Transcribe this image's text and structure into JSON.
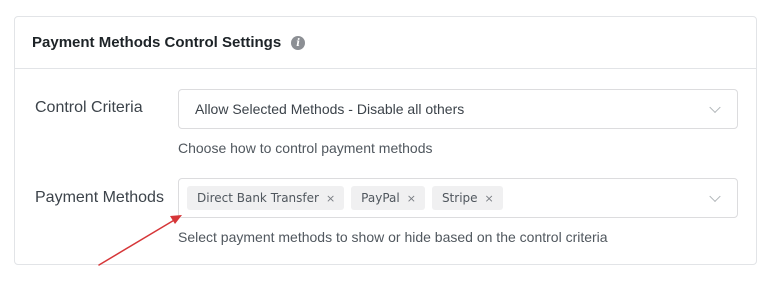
{
  "panel": {
    "title": "Payment Methods Control Settings",
    "info_icon": "info-icon"
  },
  "control_criteria": {
    "label": "Control Criteria",
    "selected": "Allow Selected Methods - Disable all others",
    "help": "Choose how to control payment methods"
  },
  "payment_methods": {
    "label": "Payment Methods",
    "tags": [
      {
        "label": "Direct Bank Transfer",
        "remove": "×"
      },
      {
        "label": "PayPal",
        "remove": "×"
      },
      {
        "label": "Stripe",
        "remove": "×"
      }
    ],
    "help": "Select payment methods to show or hide based on the control criteria"
  },
  "annotation": {
    "arrow_color": "#d63638",
    "arrow_icon": "arrow-annotation-icon"
  },
  "colors": {
    "border": "#e2e4e7",
    "tag_background": "#f0f0f1",
    "label_text": "#3c434a"
  }
}
